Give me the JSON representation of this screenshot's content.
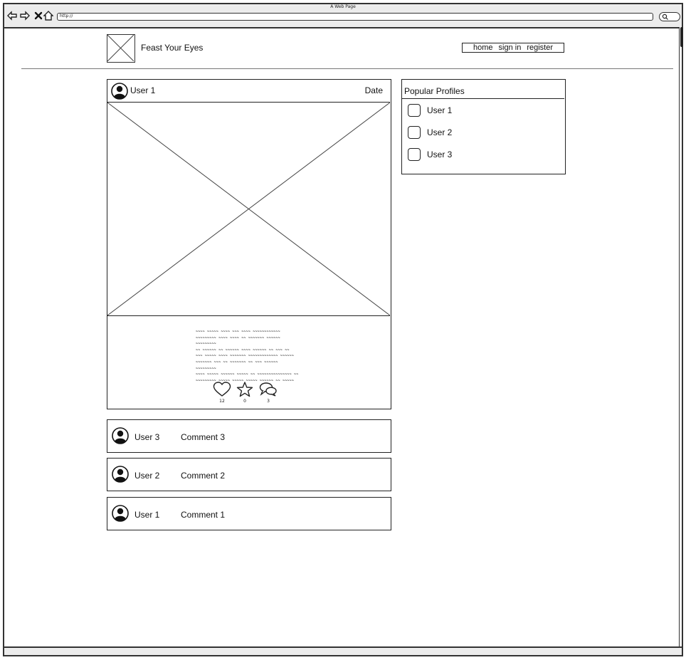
{
  "browser": {
    "window_title": "A Web Page",
    "url": "http://",
    "icons": [
      "back-icon",
      "forward-icon",
      "stop-icon",
      "home-icon",
      "search-icon"
    ]
  },
  "site": {
    "title": "Feast Your Eyes",
    "nav": [
      "home",
      "sign in",
      "register"
    ]
  },
  "post": {
    "user": "User 1",
    "date": "Date",
    "text_lines": [
      "~~~~ ~~~~~ ~~~~ ~~~ ~~~~ ~~~~~~~~~~~~",
      "~~~~~~~~~ ~~~~ ~~~~ ~~ ~~~~~~~ ~~~~~~ ~~~~~~~~~",
      "~~ ~~~~~~ ~~ ~~~~~~ ~~~~ ~~~~~~ ~~ ~~~ ~~",
      "~~~ ~~~~~ ~~~~ ~~~~~~~ ~~~~~~~~~~~~~ ~~~~~~",
      "~~~~~~~ ~~~ ~~ ~~~~~~~ ~~ ~~~ ~~~~~~ ~~~~~~~~~",
      "~~~~ ~~~~~ ~~~~~~ ~~~~~ ~~ ~~~~~~~~~~~~~~~ ~~",
      "~~~~~~~~~ ~~~~~ ~~~~~ ~~~~~ ~~~~~~ ~~ ~~~~~"
    ],
    "actions": [
      {
        "icon": "heart-icon",
        "count": "12"
      },
      {
        "icon": "star-icon",
        "count": "0"
      },
      {
        "icon": "comments-icon",
        "count": "3"
      }
    ]
  },
  "comments": [
    {
      "user": "User 3",
      "text": "Comment 3"
    },
    {
      "user": "User 2",
      "text": "Comment 2"
    },
    {
      "user": "User 1",
      "text": "Comment 1"
    }
  ],
  "popular_profiles": {
    "title": "Popular Profiles",
    "users": [
      "User 1",
      "User 2",
      "User 3"
    ]
  }
}
